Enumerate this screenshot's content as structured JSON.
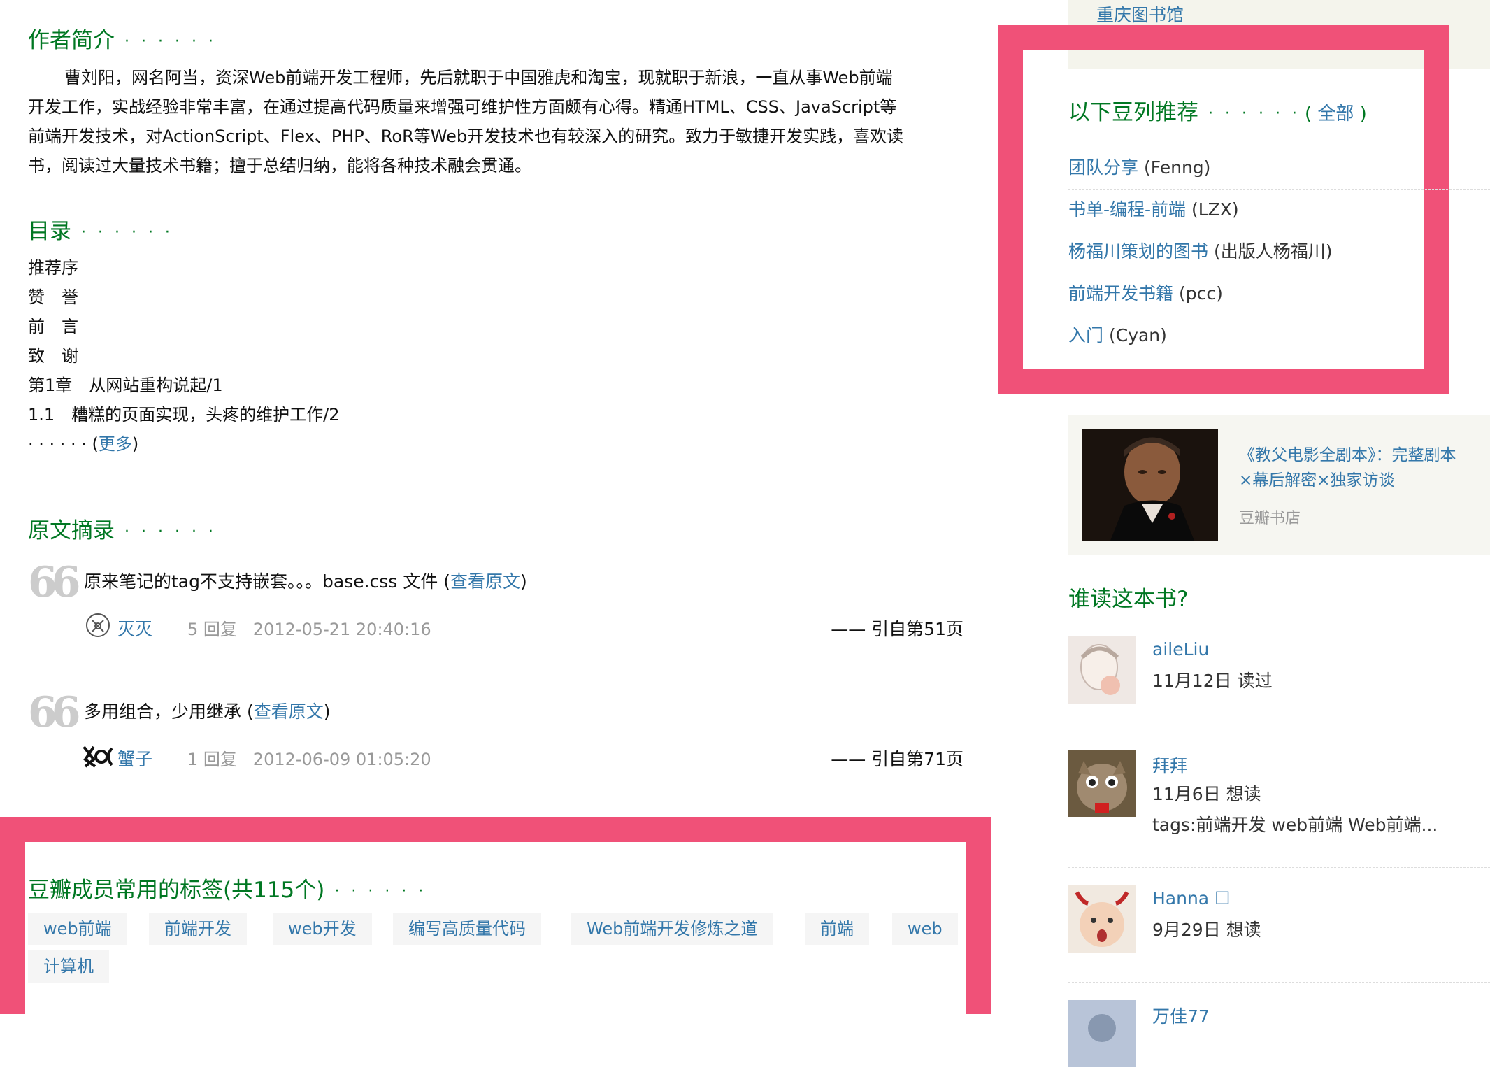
{
  "author_intro": {
    "title": "作者简介",
    "dots": "· · · · · ·",
    "lines": [
      "曹刘阳，网名阿当，资深Web前端开发工程师，先后就职于中国雅虎和淘宝，现就职于新浪，一直从事Web前端",
      "开发工作，实战经验非常丰富，在通过提高代码质量来增强可维护性方面颇有心得。精通HTML、CSS、JavaScript等",
      "前端开发技术，对ActionScript、Flex、PHP、RoR等Web开发技术也有较深入的研究。致力于敏捷开发实践，喜欢读",
      "书，阅读过大量技术书籍；擅于总结归纳，能将各种技术融会贯通。"
    ]
  },
  "toc": {
    "title": "目录",
    "dots": "· · · · · ·",
    "items": [
      "推荐序",
      "赞　誉",
      "前　言",
      "致　谢",
      "第1章　从网站重构说起/1",
      "1.1　糟糕的页面实现，头疼的维护工作/2"
    ],
    "more_dots": "· · · · · · ",
    "more_open": "(",
    "more_label": "更多",
    "more_close": ")"
  },
  "excerpts": {
    "title": "原文摘录",
    "dots": "· · · · · ·",
    "quote_glyph": "66",
    "items": [
      {
        "text": "原来笔记的tag不支持嵌套。。。base.css 文件 ",
        "open": "(",
        "link": "查看原文",
        "close": ")",
        "user": "灭灭",
        "replies": "5 回复",
        "time": "2012-05-21 20:40:16",
        "cite": "—— 引自第51页"
      },
      {
        "text": "多用组合，少用继承 ",
        "open": "(",
        "link": "查看原文",
        "close": ")",
        "user": "蟹子",
        "replies": "1 回复",
        "time": "2012-06-09 01:05:20",
        "cite": "—— 引自第71页"
      }
    ]
  },
  "tags": {
    "title": "豆瓣成员常用的标签(共115个)",
    "dots": "· · · · · ·",
    "items": [
      "web前端",
      "前端开发",
      "web开发",
      "编写高质量代码",
      "Web前端开发修炼之道",
      "前端",
      "web",
      "计算机"
    ]
  },
  "sidebar": {
    "library_link": "重庆图书馆",
    "doulists": {
      "title": "以下豆列推荐",
      "dots": "· · · · · ·",
      "all_open": "( ",
      "all_label": "全部",
      "all_close": " )",
      "items": [
        {
          "title": "团队分享",
          "author": "(Fenng)"
        },
        {
          "title": "书单-编程-前端",
          "author": "(LZX)"
        },
        {
          "title": "杨福川策划的图书",
          "author": "(出版人杨福川)"
        },
        {
          "title": "前端开发书籍",
          "author": "(pcc)"
        },
        {
          "title": "入门",
          "author": "(Cyan)"
        }
      ]
    },
    "ad": {
      "title_line1": "《教父电影全剧本》：完整剧本",
      "title_line2": "×幕后解密×独家访谈",
      "source": "豆瓣书店"
    },
    "readers": {
      "title": "谁读这本书?",
      "items": [
        {
          "name": "aileLiu",
          "date_status": "11月12日 读过",
          "tags": ""
        },
        {
          "name": "拜拜",
          "date_status": "11月6日 想读",
          "tags": "tags:前端开发 web前端 Web前端..."
        },
        {
          "name": "Hanna ☐",
          "date_status": "9月29日 想读",
          "tags": ""
        },
        {
          "name": "万佳77",
          "date_status": "",
          "tags": ""
        }
      ]
    }
  },
  "colors": {
    "highlight": "#f05178",
    "section_title": "#007722",
    "link": "#3377aa",
    "tag_bg": "#f5f5f5"
  }
}
